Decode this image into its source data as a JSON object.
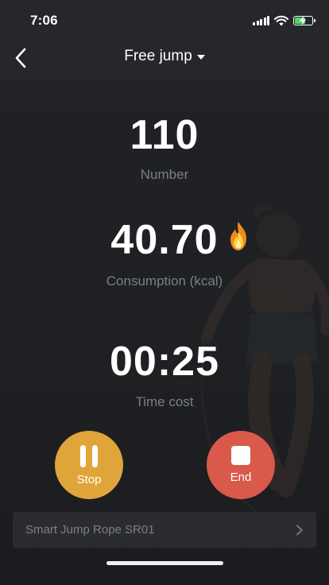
{
  "status_bar": {
    "time": "7:06"
  },
  "header": {
    "title": "Free jump"
  },
  "metrics": {
    "number": {
      "value": "110",
      "label": "Number"
    },
    "consumption": {
      "value": "40.70",
      "label": "Consumption (kcal)"
    },
    "time_cost": {
      "value": "00:25",
      "label": "Time cost"
    }
  },
  "controls": {
    "stop_label": "Stop",
    "end_label": "End"
  },
  "device": {
    "name": "Smart Jump Rope SR01"
  },
  "colors": {
    "stop": "#e0a53a",
    "end": "#d9594a",
    "background": "#1e2023",
    "battery": "#4cd964"
  }
}
